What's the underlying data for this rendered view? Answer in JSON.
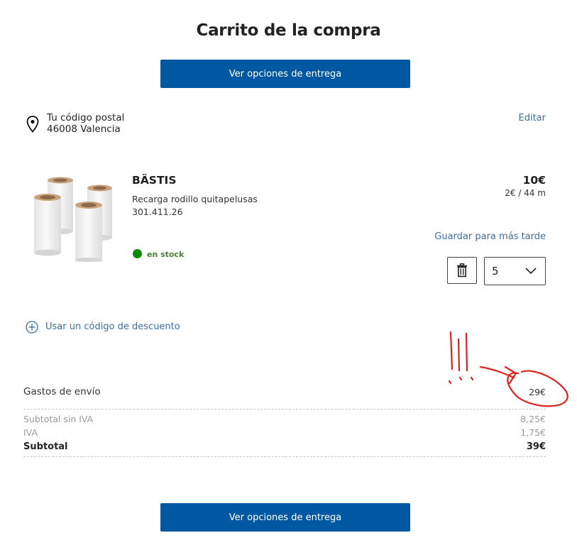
{
  "page": {
    "title": "Carrito de la compra"
  },
  "actions": {
    "delivery_options_label": "Ver opciones de entrega"
  },
  "location": {
    "label_line1": "Tu código postal",
    "label_line2": "46008 Valencia",
    "edit_label": "Editar",
    "icon": "location-pin-icon"
  },
  "product": {
    "name": "BÄSTIS",
    "description": "Recarga rodillo quitapelusas",
    "article_number": "301.411.26",
    "stock_status": "en stock",
    "price": "10€",
    "unit_price": "2€ / 44 m",
    "save_for_later_label": "Guardar para más tarde",
    "quantity": "5",
    "stock_color": "#0a8a00"
  },
  "discount": {
    "label": "Usar un código de descuento",
    "icon": "plus-circle-icon"
  },
  "summary": {
    "shipping_label": "Gastos de envío",
    "shipping_value": "29€",
    "subtotal_excl_vat_label": "Subtotal sin IVA",
    "subtotal_excl_vat_value": "8,25€",
    "vat_label": "IVA",
    "vat_value": "1,75€",
    "subtotal_label": "Subtotal",
    "subtotal_value": "39€"
  },
  "theme": {
    "primary": "#0058a3",
    "link": "#3c6ea1",
    "annotation": "#e02020"
  }
}
